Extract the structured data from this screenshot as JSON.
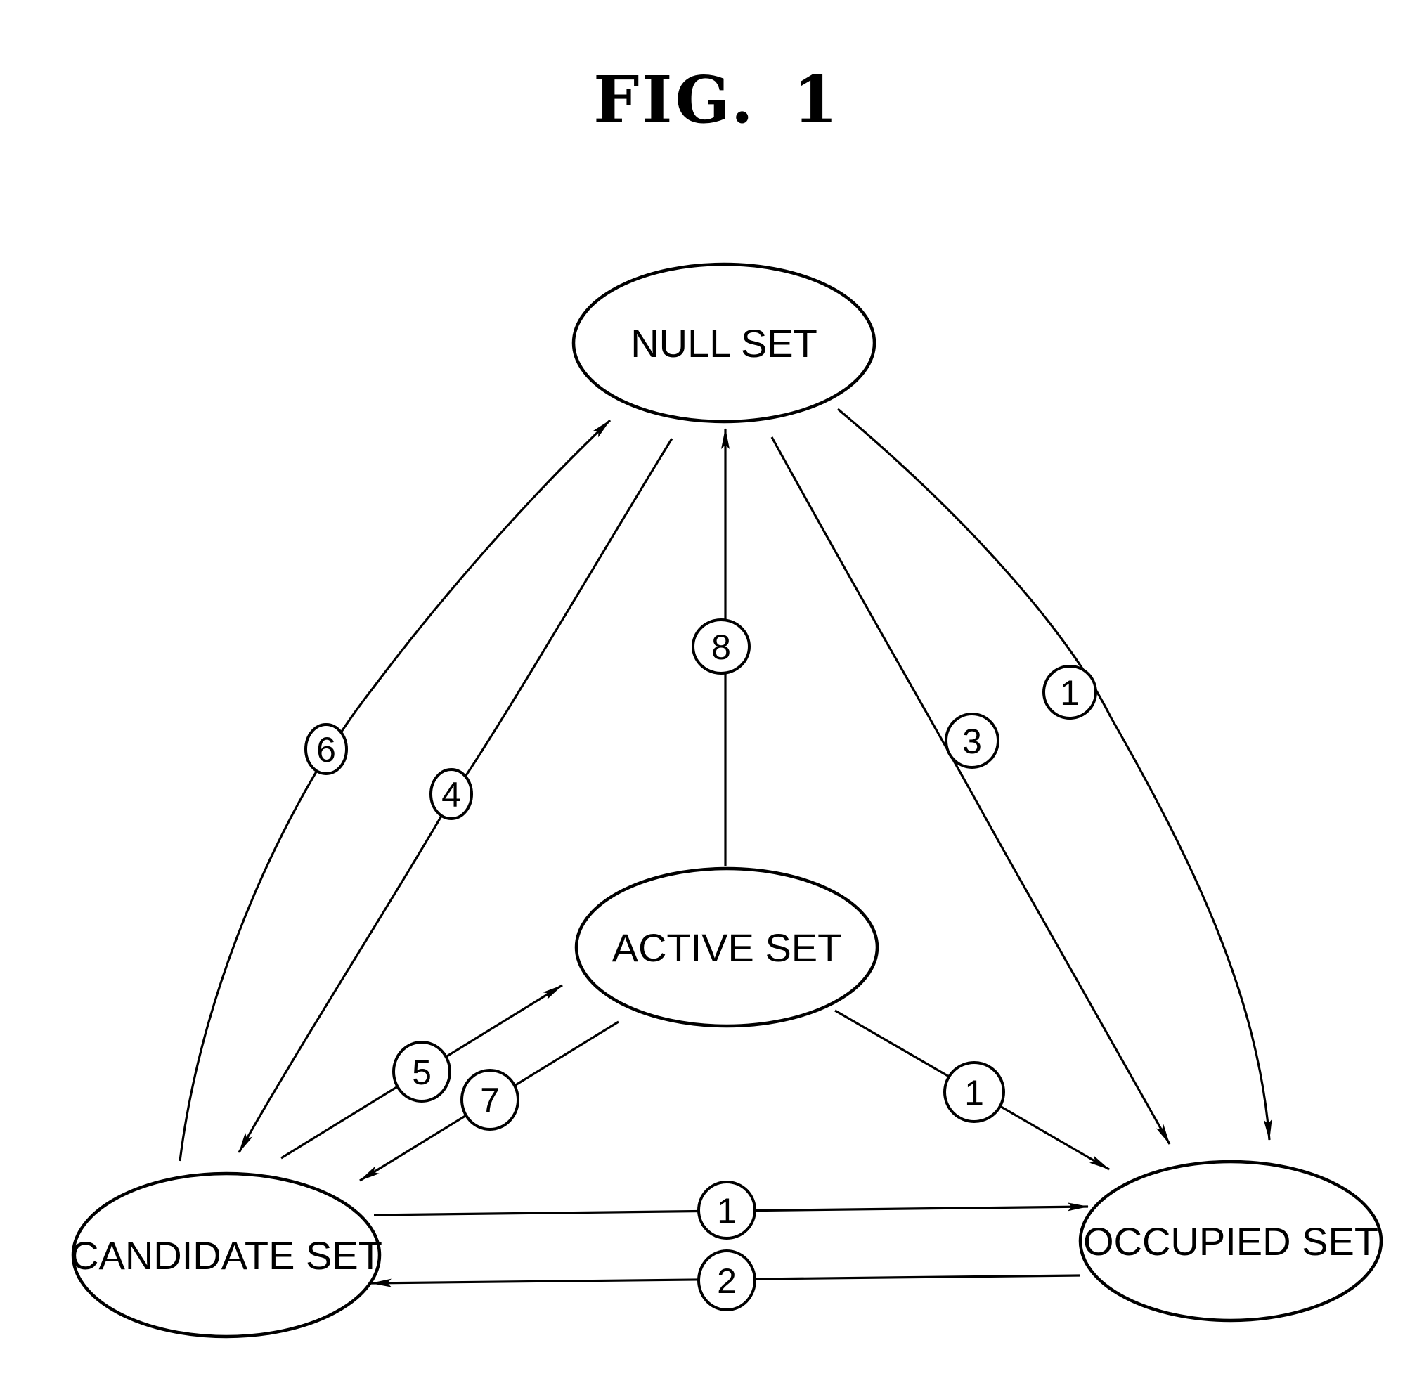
{
  "figure": {
    "title_prefix": "FIG.",
    "title_number": "1"
  },
  "nodes": {
    "null_set": "NULL SET",
    "active_set": "ACTIVE SET",
    "candidate_set": "CANDIDATE SET",
    "occupied_set": "OCCUPIED SET"
  },
  "edges": [
    {
      "id": "e6",
      "label": "6",
      "from": "CANDIDATE SET",
      "to": "NULL SET"
    },
    {
      "id": "e4",
      "label": "4",
      "from": "NULL SET",
      "to": "CANDIDATE SET"
    },
    {
      "id": "e8",
      "label": "8",
      "from": "ACTIVE SET",
      "to": "NULL SET"
    },
    {
      "id": "e3",
      "label": "3",
      "from": "NULL SET",
      "to": "OCCUPIED SET"
    },
    {
      "id": "e1a",
      "label": "1",
      "from": "NULL SET",
      "to": "OCCUPIED SET"
    },
    {
      "id": "e5",
      "label": "5",
      "from": "CANDIDATE SET",
      "to": "ACTIVE SET"
    },
    {
      "id": "e7",
      "label": "7",
      "from": "ACTIVE SET",
      "to": "CANDIDATE SET"
    },
    {
      "id": "e1b",
      "label": "1",
      "from": "ACTIVE SET",
      "to": "OCCUPIED SET"
    },
    {
      "id": "e1c",
      "label": "1",
      "from": "CANDIDATE SET",
      "to": "OCCUPIED SET"
    },
    {
      "id": "e2",
      "label": "2",
      "from": "OCCUPIED SET",
      "to": "CANDIDATE SET"
    }
  ]
}
